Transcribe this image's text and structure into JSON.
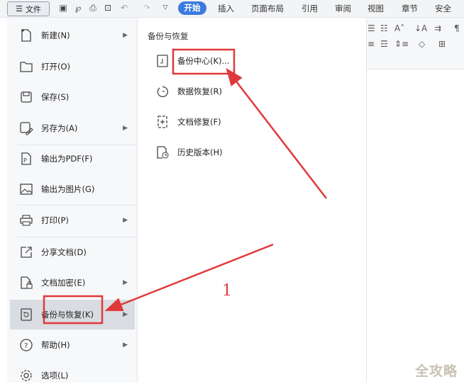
{
  "topbar": {
    "file_label": "文件",
    "tabs": [
      "开始",
      "插入",
      "页面布局",
      "引用",
      "审阅",
      "视图",
      "章节",
      "安全"
    ]
  },
  "menu": {
    "items": [
      {
        "label": "新建(N)",
        "icon": "new-file-icon",
        "has_arrow": true
      },
      {
        "label": "打开(O)",
        "icon": "folder-open-icon",
        "has_arrow": false
      },
      {
        "label": "保存(S)",
        "icon": "save-icon",
        "has_arrow": false
      },
      {
        "label": "另存为(A)",
        "icon": "save-as-icon",
        "has_arrow": true
      },
      {
        "label": "输出为PDF(F)",
        "icon": "pdf-export-icon",
        "has_arrow": false
      },
      {
        "label": "输出为图片(G)",
        "icon": "image-export-icon",
        "has_arrow": false
      },
      {
        "label": "打印(P)",
        "icon": "printer-icon",
        "has_arrow": true
      },
      {
        "label": "分享文档(D)",
        "icon": "share-icon",
        "has_arrow": false
      },
      {
        "label": "文档加密(E)",
        "icon": "encrypt-icon",
        "has_arrow": true
      },
      {
        "label": "备份与恢复(K)",
        "icon": "backup-icon",
        "has_arrow": true,
        "active": true
      },
      {
        "label": "帮助(H)",
        "icon": "help-icon",
        "has_arrow": true
      },
      {
        "label": "选项(L)",
        "icon": "options-gear-icon",
        "has_arrow": false
      }
    ]
  },
  "submenu": {
    "title": "备份与恢复",
    "items": [
      {
        "label": "备份中心(K)...",
        "icon": "backup-center-icon"
      },
      {
        "label": "数据恢复(R)",
        "icon": "data-recovery-icon"
      },
      {
        "label": "文档修复(F)",
        "icon": "doc-repair-icon"
      },
      {
        "label": "历史版本(H)",
        "icon": "history-version-icon"
      }
    ]
  },
  "annotation": {
    "number": "1",
    "color": "#e0393b"
  },
  "watermark": "全攻略",
  "colors": {
    "accent": "#3b7bdf",
    "highlight_box": "#e0393b",
    "menu_bg": "#f7f8fa",
    "active_bg": "#d9dce1"
  }
}
